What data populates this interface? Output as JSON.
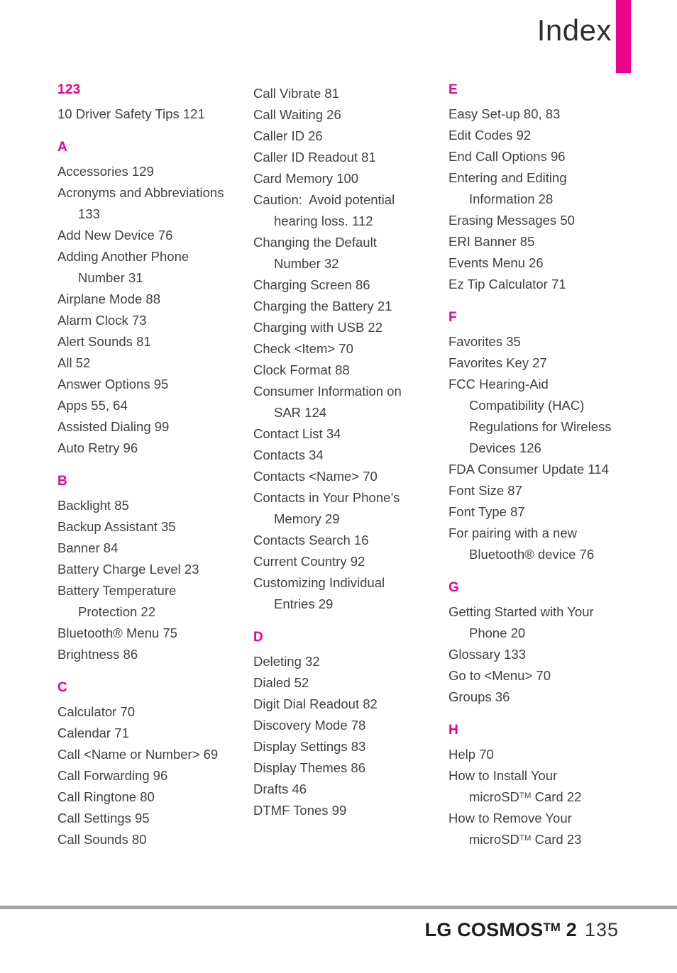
{
  "header": {
    "title": "Index",
    "accent_color": "#ec008c"
  },
  "footer": {
    "brand": "LG COSMOS",
    "brand_tm": "TM",
    "brand_suffix": "2",
    "page_number": "135",
    "rule_color": "#a3a3a3"
  },
  "columns": [
    {
      "id": "column-1",
      "sections": [
        {
          "letter": "123",
          "entries": [
            {
              "text": "10 Driver Safety Tips 121"
            }
          ]
        },
        {
          "letter": "A",
          "entries": [
            {
              "text": "Accessories 129"
            },
            {
              "text": "Acronyms and Abbreviations",
              "cont": "133"
            },
            {
              "text": "Add New Device 76"
            },
            {
              "text": "Adding Another Phone",
              "cont": "Number 31"
            },
            {
              "text": "Airplane Mode 88"
            },
            {
              "text": "Alarm Clock 73"
            },
            {
              "text": "Alert Sounds 81"
            },
            {
              "text": "All 52"
            },
            {
              "text": "Answer Options 95"
            },
            {
              "text": "Apps 55, 64"
            },
            {
              "text": "Assisted Dialing 99"
            },
            {
              "text": "Auto Retry 96"
            }
          ]
        },
        {
          "letter": "B",
          "entries": [
            {
              "text": "Backlight 85"
            },
            {
              "text": "Backup Assistant 35"
            },
            {
              "text": "Banner 84"
            },
            {
              "text": "Battery Charge Level 23"
            },
            {
              "text": "Battery Temperature",
              "cont": "Protection 22"
            },
            {
              "text": "Bluetooth® Menu 75"
            },
            {
              "text": "Brightness 86"
            }
          ]
        },
        {
          "letter": "C",
          "entries": [
            {
              "text": "Calculator 70"
            },
            {
              "text": "Calendar 71"
            },
            {
              "text": "Call <Name or Number> 69"
            },
            {
              "text": "Call Forwarding 96"
            },
            {
              "text": "Call Ringtone 80"
            },
            {
              "text": "Call Settings 95"
            },
            {
              "text": "Call Sounds 80"
            }
          ]
        }
      ]
    },
    {
      "id": "column-2",
      "sections": [
        {
          "letter": "",
          "entries": [
            {
              "text": "Call Vibrate 81"
            },
            {
              "text": "Call Waiting 26"
            },
            {
              "text": "Caller ID 26"
            },
            {
              "text": "Caller ID Readout 81"
            },
            {
              "text": "Card Memory 100"
            },
            {
              "text": "Caution:  Avoid potential",
              "cont": "hearing loss. 112"
            },
            {
              "text": "Changing the Default",
              "cont": "Number 32"
            },
            {
              "text": "Charging Screen 86"
            },
            {
              "text": "Charging the Battery 21"
            },
            {
              "text": "Charging with USB 22"
            },
            {
              "text": "Check <Item> 70"
            },
            {
              "text": "Clock Format 88"
            },
            {
              "text": "Consumer Information on",
              "cont": "SAR 124"
            },
            {
              "text": "Contact List 34"
            },
            {
              "text": "Contacts 34"
            },
            {
              "text": "Contacts <Name> 70"
            },
            {
              "text": "Contacts in Your Phone’s",
              "cont": "Memory 29"
            },
            {
              "text": "Contacts Search 16"
            },
            {
              "text": "Current Country 92"
            },
            {
              "text": "Customizing Individual",
              "cont": "Entries 29"
            }
          ]
        },
        {
          "letter": "D",
          "entries": [
            {
              "text": "Deleting 32"
            },
            {
              "text": "Dialed 52"
            },
            {
              "text": "Digit Dial Readout 82"
            },
            {
              "text": "Discovery Mode 78"
            },
            {
              "text": "Display Settings 83"
            },
            {
              "text": "Display Themes 86"
            },
            {
              "text": "Drafts 46"
            },
            {
              "text": "DTMF Tones 99"
            }
          ]
        }
      ]
    },
    {
      "id": "column-3",
      "sections": [
        {
          "letter": "E",
          "entries": [
            {
              "text": "Easy Set-up 80, 83"
            },
            {
              "text": "Edit Codes 92"
            },
            {
              "text": "End Call Options 96"
            },
            {
              "text": "Entering and Editing",
              "cont": "Information 28"
            },
            {
              "text": "Erasing Messages 50"
            },
            {
              "text": "ERI Banner 85"
            },
            {
              "text": "Events Menu 26"
            },
            {
              "text": "Ez Tip Calculator 71"
            }
          ]
        },
        {
          "letter": "F",
          "entries": [
            {
              "text": "Favorites 35"
            },
            {
              "text": "Favorites Key 27"
            },
            {
              "text": "FCC Hearing-Aid",
              "cont": "Compatibility (HAC)",
              "cont2": "Regulations for Wireless",
              "cont3": "Devices 126"
            },
            {
              "text": "FDA Consumer Update 114"
            },
            {
              "text": "Font Size 87"
            },
            {
              "text": "Font Type 87"
            },
            {
              "text": "For pairing with a new",
              "cont": "Bluetooth® device 76"
            }
          ]
        },
        {
          "letter": "G",
          "entries": [
            {
              "text": "Getting Started with Your",
              "cont": "Phone 20"
            },
            {
              "text": "Glossary 133"
            },
            {
              "text": "Go to <Menu> 70"
            },
            {
              "text": "Groups 36"
            }
          ]
        },
        {
          "letter": "H",
          "entries": [
            {
              "text": "Help 70"
            },
            {
              "text": "How to Install Your",
              "cont_html": "microSD<sup class=\"tm\">TM</sup> Card 22"
            },
            {
              "text": "How to Remove Your",
              "cont_html": "microSD<sup class=\"tm\">TM</sup> Card 23"
            }
          ]
        }
      ]
    }
  ]
}
